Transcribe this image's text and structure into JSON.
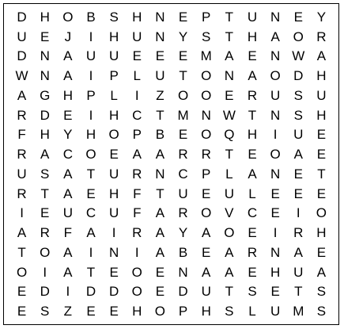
{
  "puzzle": {
    "grid": [
      [
        "D",
        "H",
        "O",
        "B",
        "S",
        "H",
        "N",
        "E",
        "P",
        "T",
        "U",
        "N",
        "E",
        "Y"
      ],
      [
        "U",
        "E",
        "J",
        "I",
        "H",
        "U",
        "N",
        "Y",
        "S",
        "T",
        "H",
        "A",
        "O",
        "R"
      ],
      [
        "D",
        "N",
        "A",
        "U",
        "U",
        "E",
        "E",
        "E",
        "M",
        "A",
        "E",
        "N",
        "W",
        "A"
      ],
      [
        "W",
        "N",
        "A",
        "I",
        "P",
        "L",
        "U",
        "T",
        "O",
        "N",
        "A",
        "O",
        "D",
        "H"
      ],
      [
        "A",
        "G",
        "H",
        "P",
        "L",
        "I",
        "Z",
        "O",
        "O",
        "E",
        "R",
        "U",
        "S",
        "U"
      ],
      [
        "R",
        "D",
        "E",
        "I",
        "H",
        "C",
        "T",
        "M",
        "N",
        "W",
        "T",
        "N",
        "S",
        "H"
      ],
      [
        "F",
        "H",
        "Y",
        "H",
        "O",
        "P",
        "B",
        "E",
        "O",
        "Q",
        "H",
        "I",
        "U",
        "E"
      ],
      [
        "R",
        "A",
        "C",
        "O",
        "E",
        "A",
        "A",
        "R",
        "R",
        "T",
        "E",
        "O",
        "A",
        "E"
      ],
      [
        "U",
        "S",
        "A",
        "T",
        "U",
        "R",
        "N",
        "C",
        "P",
        "L",
        "A",
        "N",
        "E",
        "T"
      ],
      [
        "R",
        "T",
        "A",
        "E",
        "H",
        "F",
        "T",
        "U",
        "E",
        "U",
        "L",
        "E",
        "E",
        "E"
      ],
      [
        "I",
        "E",
        "U",
        "C",
        "U",
        "F",
        "A",
        "R",
        "O",
        "V",
        "C",
        "E",
        "I",
        "O"
      ],
      [
        "A",
        "R",
        "F",
        "A",
        "I",
        "R",
        "A",
        "Y",
        "A",
        "O",
        "E",
        "I",
        "R",
        "H"
      ],
      [
        "T",
        "O",
        "A",
        "I",
        "N",
        "I",
        "A",
        "B",
        "E",
        "A",
        "R",
        "N",
        "A",
        "E"
      ],
      [
        "O",
        "I",
        "A",
        "T",
        "E",
        "O",
        "E",
        "N",
        "A",
        "A",
        "E",
        "H",
        "U",
        "A"
      ],
      [
        "E",
        "D",
        "I",
        "D",
        "D",
        "O",
        "E",
        "D",
        "U",
        "T",
        "S",
        "E",
        "T",
        "S"
      ],
      [
        "E",
        "S",
        "Z",
        "E",
        "E",
        "H",
        "O",
        "P",
        "H",
        "S",
        "L",
        "U",
        "M",
        "S"
      ]
    ]
  }
}
